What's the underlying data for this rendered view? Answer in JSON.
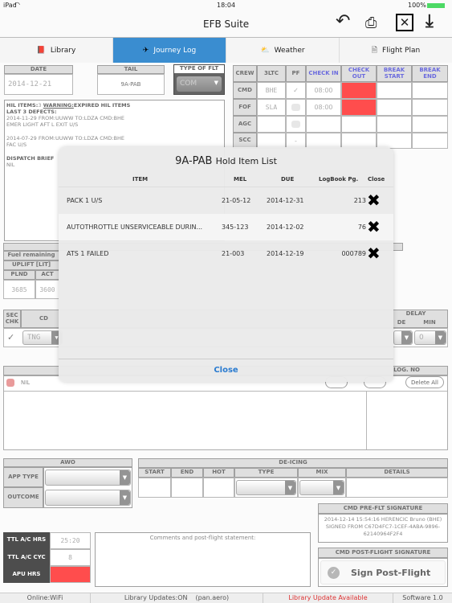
{
  "status_bar": {
    "device": "iPad",
    "time": "18:04",
    "battery": "100%"
  },
  "header": {
    "title": "EFB Suite",
    "icons": [
      "back-icon",
      "print-icon",
      "close-box-icon",
      "download-icon"
    ]
  },
  "tabs": [
    {
      "label": "Library",
      "icon": "book-icon"
    },
    {
      "label": "Journey Log",
      "icon": "plane-icon",
      "active": true
    },
    {
      "label": "Weather",
      "icon": "weather-icon"
    },
    {
      "label": "Flight Plan",
      "icon": "document-icon"
    }
  ],
  "accent": "#3a8dd0",
  "flight": {
    "date_label": "DATE",
    "date": "2014-12-21",
    "tail_label": "TAIL",
    "tail": "9A-PAB",
    "type_label": "TYPE OF FLT",
    "type": "COM"
  },
  "hil": {
    "items_label": "HIL ITEMS:",
    "items_count": "3",
    "warning_label": "WARNING:",
    "warning_text": "EXPIRED HIL ITEMS",
    "last_label": "LAST 3 DEFECTS:",
    "defects": [
      {
        "line1": "2014-11-29 FROM:UUWW TO:LDZA CMD:BHE",
        "line2": "EMER LIGHT AFT L EXIT U/S"
      },
      {
        "line1": "2014-07-29 FROM:UUWW TO:LDZA CMD:BHE",
        "line2": "FAC U/S"
      }
    ],
    "dispatch_label": "DISPATCH BRIEF",
    "dispatch_value": "NIL"
  },
  "crew": {
    "headers": [
      "CREW",
      "3LTC",
      "PF",
      "CHECK IN",
      "CHECK OUT",
      "BREAK START",
      "BREAK END"
    ],
    "rows": [
      {
        "role": "CMD",
        "ltc": "BHE",
        "pf": "✓",
        "in": "08:00"
      },
      {
        "role": "FOF",
        "ltc": "SLA",
        "pf": "",
        "in": "08:00"
      },
      {
        "role": "AGC",
        "ltc": "",
        "pf": "",
        "in": ""
      },
      {
        "role": "SCC",
        "ltc": "",
        "pf": "-",
        "in": ""
      }
    ]
  },
  "fuel": {
    "remaining_label": "Fuel remaining",
    "uplift_label": "UPLIFT [LIT]",
    "plnd_label": "PLND",
    "act_label": "ACT",
    "plnd": "3685",
    "act": "3600"
  },
  "sector": {
    "sec_chk_label": "SEC CHK",
    "cd_label": "CD",
    "cd_value": "TNG",
    "delay_label": "DELAY",
    "code_label": "DE",
    "min_label": "MIN",
    "min_value": "0"
  },
  "defects_list": {
    "value": "NIL",
    "log_no_label": "LOG. NO",
    "delete_all": "Delete All"
  },
  "awo": {
    "title": "AWO",
    "app_type_label": "APP TYPE",
    "outcome_label": "OUTCOME"
  },
  "deicing": {
    "title": "DE-ICING",
    "headers": [
      "START",
      "END",
      "HOT",
      "TYPE",
      "MIX",
      "DETAILS"
    ]
  },
  "pre_sig": {
    "title": "CMD PRE-FLT SIGNATURE",
    "text": "2014-12-14 15:54:16 HERENCIC Bruno (BHE) SIGNED FROM C67D4FC7-1CEF-4ABA-9896-62140964F2F4"
  },
  "totals": {
    "hrs_label": "TTL A/C HRS",
    "hrs": "25:20",
    "cyc_label": "TTL A/C CYC",
    "cyc": "8",
    "apu_label": "APU HRS"
  },
  "comments": {
    "label": "Comments and post-flight statement:"
  },
  "post_sig": {
    "title": "CMD POST-FLIGHT SIGNATURE",
    "button": "Sign Post-Flight"
  },
  "modal": {
    "tail": "9A-PAB",
    "title": "Hold Item List",
    "headers": {
      "item": "ITEM",
      "mel": "MEL",
      "due": "DUE",
      "logbook": "LogBook Pg.",
      "close": "Close"
    },
    "rows": [
      {
        "item": "PACK 1 U/S",
        "mel": "21-05-12",
        "due": "2014-12-31",
        "page": "213"
      },
      {
        "item": "AUTOTHROTTLE UNSERVICEABLE DURIN...",
        "mel": "345-123",
        "due": "2014-12-02",
        "page": "76"
      },
      {
        "item": "ATS 1 FAILED",
        "mel": "21-003",
        "due": "2014-12-19",
        "page": "000789"
      }
    ],
    "close_button": "Close"
  },
  "footer": {
    "online": "Online:WiFi",
    "updates": "Library Updates:ON",
    "domain": "(pan.aero)",
    "update_available": "Library Update Available",
    "software": "Software 1.0"
  }
}
